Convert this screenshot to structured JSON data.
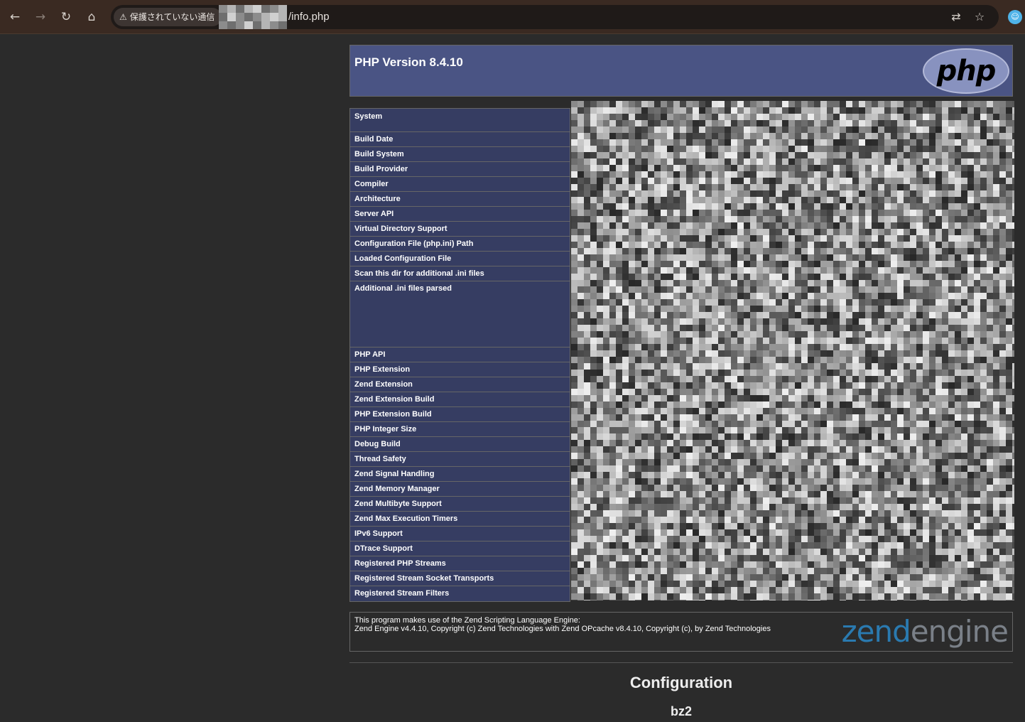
{
  "browser": {
    "security_label": "保護されていない通信",
    "url_path": "/info.php",
    "icons": [
      "back-icon",
      "forward-icon",
      "reload-icon",
      "home-icon",
      "translate-icon",
      "bookmark-star-icon",
      "profile-icon"
    ]
  },
  "php": {
    "version_title": "PHP Version 8.4.10",
    "logo_text": "php",
    "rows": [
      "System",
      "Build Date",
      "Build System",
      "Build Provider",
      "Compiler",
      "Architecture",
      "Server API",
      "Virtual Directory Support",
      "Configuration File (php.ini) Path",
      "Loaded Configuration File",
      "Scan this dir for additional .ini files",
      "Additional .ini files parsed",
      "PHP API",
      "PHP Extension",
      "Zend Extension",
      "Zend Extension Build",
      "PHP Extension Build",
      "PHP Integer Size",
      "Debug Build",
      "Thread Safety",
      "Zend Signal Handling",
      "Zend Memory Manager",
      "Zend Multibyte Support",
      "Zend Max Execution Timers",
      "IPv6 Support",
      "DTrace Support",
      "Registered PHP Streams",
      "Registered Stream Socket Transports",
      "Registered Stream Filters"
    ]
  },
  "zend": {
    "line1": "This program makes use of the Zend Scripting Language Engine:",
    "line2": "Zend Engine v4.4.10, Copyright (c) Zend Technologies with Zend OPcache v8.4.10, Copyright (c), by Zend Technologies",
    "logo_zend": "zend",
    "logo_engine": "engine"
  },
  "sections": {
    "configuration": "Configuration",
    "bz2": "bz2"
  }
}
